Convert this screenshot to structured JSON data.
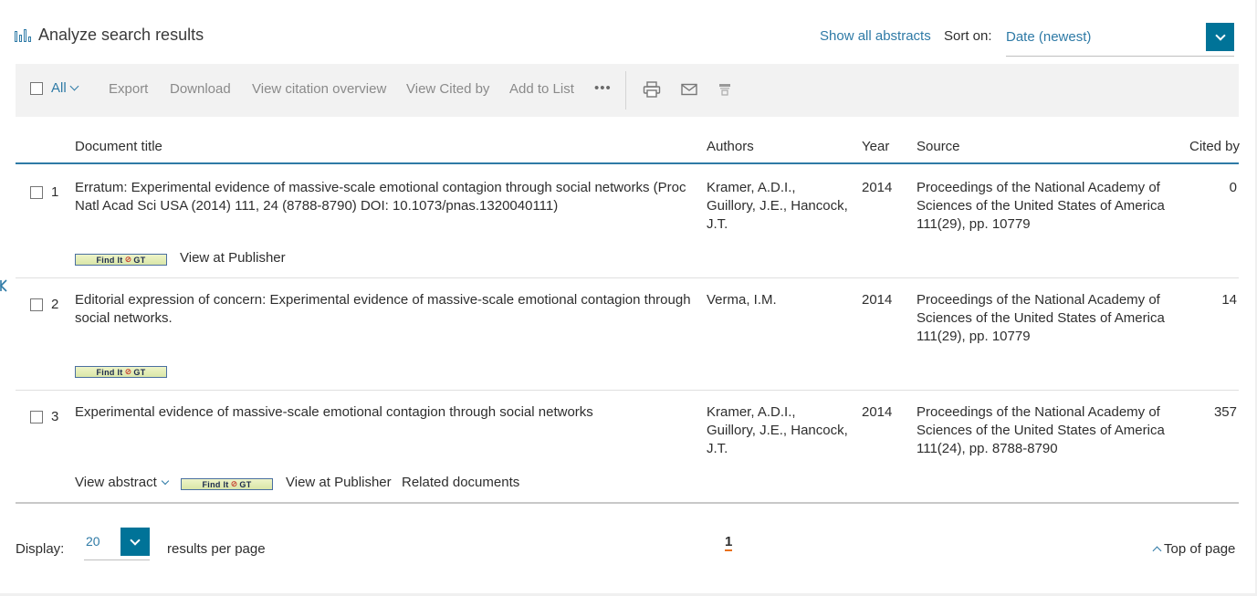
{
  "header": {
    "title": "Analyze search results",
    "show_abstracts": "Show all abstracts",
    "sort_label": "Sort on:",
    "sort_value": "Date (newest)"
  },
  "toolbar": {
    "all_label": "All",
    "export": "Export",
    "download": "Download",
    "citation_overview": "View citation overview",
    "cited_by": "View Cited by",
    "add_to_list": "Add to List",
    "more": "•••",
    "icons": [
      "print-icon",
      "email-icon",
      "bibliography-icon"
    ]
  },
  "columns": {
    "title": "Document title",
    "authors": "Authors",
    "year": "Year",
    "source": "Source",
    "cited_by": "Cited by"
  },
  "rows": [
    {
      "num": "1",
      "title_line1": "Erratum: Experimental evidence of massive-scale emotional contagion through social networks (Proc",
      "title_line2": "Natl Acad Sci USA (2014) 111, 24 (8788-8790) DOI: 10.1073/pnas.1320040111)",
      "authors_line1": "Kramer, A.D.I.,",
      "authors_line2": "Guillory, J.E., Hancock,",
      "authors_line3": "J.T.",
      "year": "2014",
      "source_line1": "Proceedings of the National Academy of",
      "source_line2": "Sciences of the United States of America",
      "source_line3": "111(29), pp. 10779",
      "cited": "0",
      "findit": "Find It",
      "view_publisher": "View at Publisher"
    },
    {
      "num": "2",
      "title_line1": "Editorial expression of concern: Experimental evidence of massive-scale emotional contagion through",
      "title_line2": "social networks.",
      "authors_line1": "Verma, I.M.",
      "year": "2014",
      "source_line1": "Proceedings of the National Academy of",
      "source_line2": "Sciences of the United States of America",
      "source_line3": "111(29), pp. 10779",
      "cited": "14",
      "findit": "Find It"
    },
    {
      "num": "3",
      "title_line1": "Experimental evidence of massive-scale emotional contagion through social networks",
      "authors_line1": "Kramer, A.D.I.,",
      "authors_line2": "Guillory, J.E., Hancock,",
      "authors_line3": "J.T.",
      "year": "2014",
      "source_line1": "Proceedings of the National Academy of",
      "source_line2": "Sciences of the United States of America",
      "source_line3": "111(24), pp. 8788-8790",
      "cited": "357",
      "view_abstract": "View abstract",
      "findit": "Find It",
      "view_publisher": "View at Publisher",
      "related": "Related documents"
    }
  ],
  "footer": {
    "display_label": "Display:",
    "display_value": "20",
    "results_per_page": "results per page",
    "current_page": "1",
    "top_of_page": "Top of page"
  },
  "colors": {
    "accent": "#2e7aa6",
    "button": "#007398",
    "pager_underline": "#e9711c"
  }
}
